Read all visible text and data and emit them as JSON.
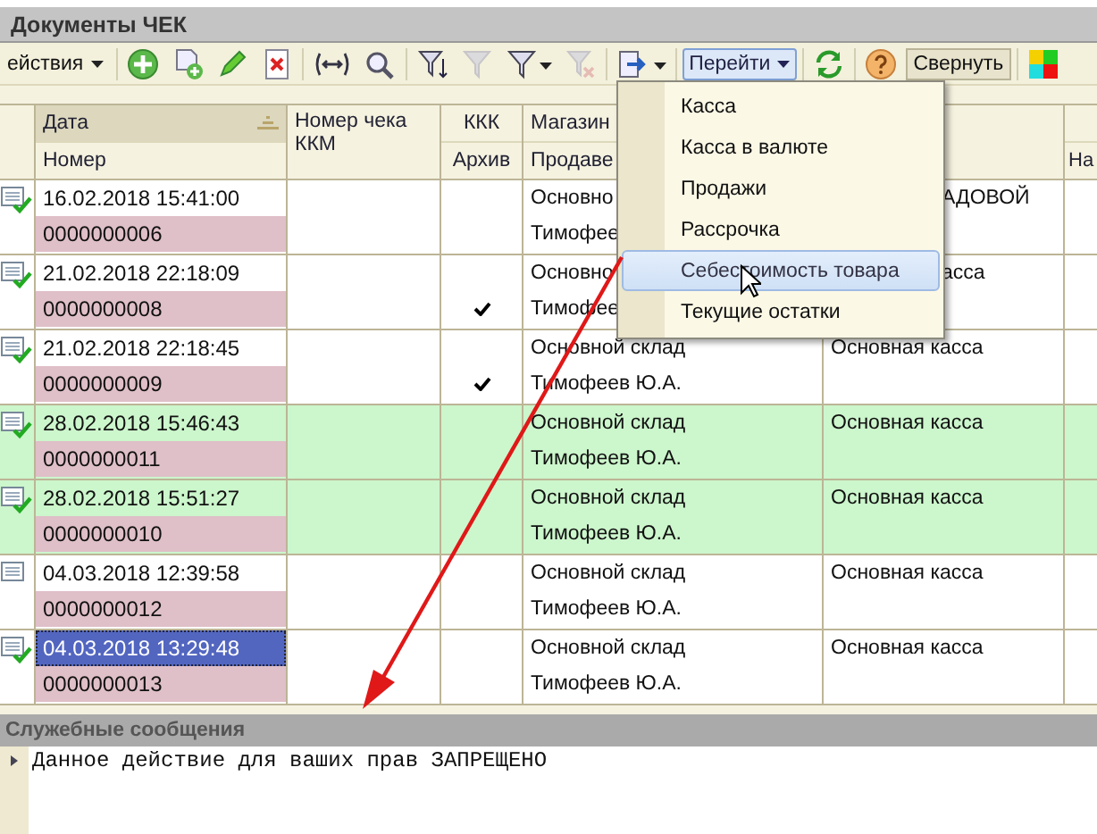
{
  "window": {
    "title": "Документы ЧЕК"
  },
  "toolbar": {
    "actions_menu": "ействия",
    "goto_button": {
      "label": "Перейти",
      "pressed": true
    },
    "collapse_button": {
      "label": "Свернуть",
      "pressed": true
    }
  },
  "table": {
    "columns": [
      {
        "top": "Дата",
        "bottom": "Номер",
        "sorted": true
      },
      {
        "top": "Номер чека ККМ"
      },
      {
        "top": "ККК",
        "bottom": "Архив"
      },
      {
        "top": "Магазин",
        "bottom": "Продаве"
      },
      {
        "bottom": "На"
      }
    ],
    "rows": [
      {
        "posted": true,
        "highlight": false,
        "selected": false,
        "date": "16.02.2018 15:41:00",
        "number": "0000000006",
        "archive": false,
        "store": "Основно",
        "seller": "Тимофее",
        "cash": "АДОВОЙ",
        "cash_clipped": true
      },
      {
        "posted": true,
        "highlight": false,
        "selected": false,
        "date": "21.02.2018 22:18:09",
        "number": "0000000008",
        "archive": true,
        "store": "Основно",
        "seller": "Тимофее",
        "cash": "асса",
        "cash_clipped": true
      },
      {
        "posted": true,
        "highlight": false,
        "selected": false,
        "date": "21.02.2018 22:18:45",
        "number": "0000000009",
        "archive": true,
        "store": "Основной склад",
        "seller": "Тимофеев Ю.А.",
        "cash": "Основная касса",
        "cash_clipped": false
      },
      {
        "posted": true,
        "highlight": true,
        "selected": false,
        "date": "28.02.2018 15:46:43",
        "number": "0000000011",
        "archive": false,
        "store": "Основной склад",
        "seller": "Тимофеев Ю.А.",
        "cash": "Основная касса",
        "cash_clipped": false
      },
      {
        "posted": true,
        "highlight": true,
        "selected": false,
        "date": "28.02.2018 15:51:27",
        "number": "0000000010",
        "archive": false,
        "store": "Основной склад",
        "seller": "Тимофеев Ю.А.",
        "cash": "Основная касса",
        "cash_clipped": false
      },
      {
        "posted": false,
        "highlight": false,
        "selected": false,
        "date": "04.03.2018 12:39:58",
        "number": "0000000012",
        "archive": false,
        "store": "Основной склад",
        "seller": "Тимофеев Ю.А.",
        "cash": "Основная касса",
        "cash_clipped": false
      },
      {
        "posted": true,
        "highlight": false,
        "selected": true,
        "date": "04.03.2018 13:29:48",
        "number": "0000000013",
        "archive": false,
        "store": "Основной склад",
        "seller": "Тимофеев Ю.А.",
        "cash": "Основная касса",
        "cash_clipped": false
      }
    ]
  },
  "goto_menu": {
    "items": [
      {
        "label": "Касса",
        "selected": false
      },
      {
        "label": "Касса в валюте",
        "selected": false
      },
      {
        "label": "Продажи",
        "selected": false
      },
      {
        "label": "Рассрочка",
        "selected": false
      },
      {
        "label": "Себестоимость товара",
        "selected": true
      },
      {
        "label": "Текущие остатки",
        "selected": false
      }
    ]
  },
  "messages": {
    "title": "Служебные сообщения",
    "lines": [
      "Данное действие для ваших прав ЗАПРЕЩЕНО"
    ]
  }
}
